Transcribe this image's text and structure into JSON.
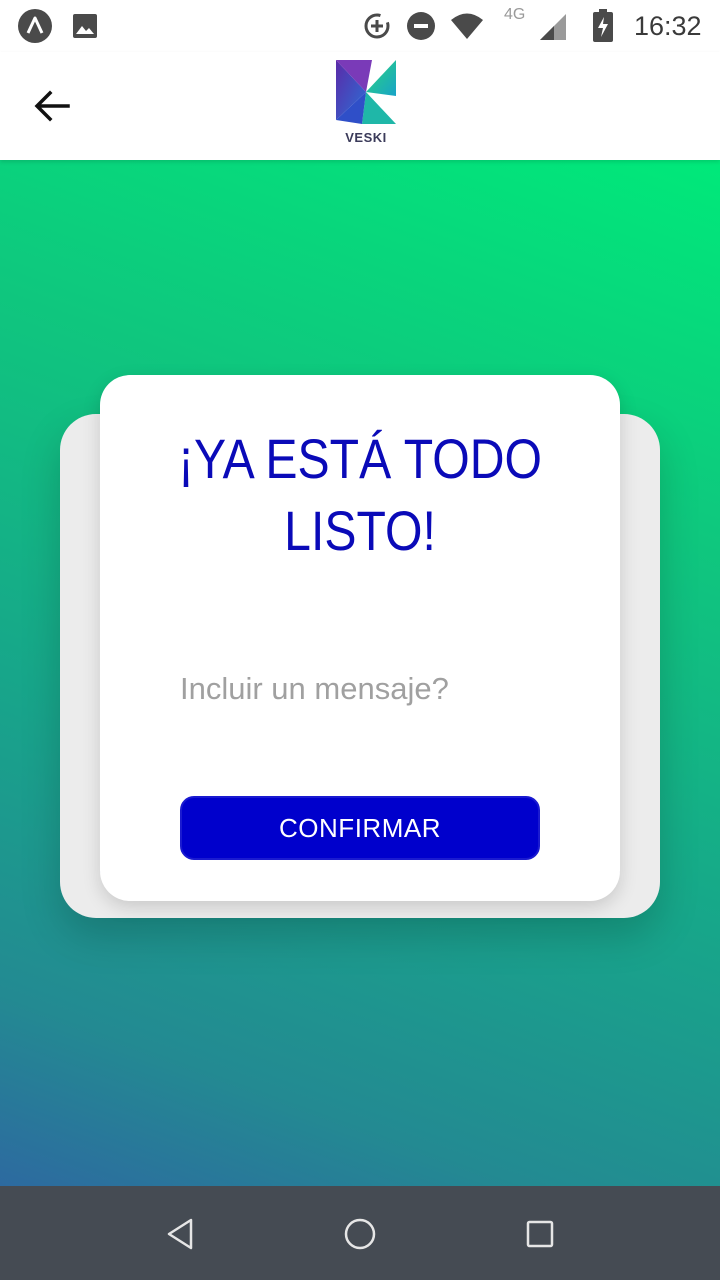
{
  "status_bar": {
    "time": "16:32",
    "network_label": "4G",
    "icons": [
      "app-icon",
      "image-icon",
      "data-saver-icon",
      "do-not-disturb-icon",
      "wifi-icon",
      "signal-icon",
      "battery-charging-icon"
    ]
  },
  "app_bar": {
    "back_icon": "arrow-left-icon",
    "logo_text": "VESKI"
  },
  "card": {
    "title": "¡YA ESTÁ TODO LISTO!",
    "message_placeholder": "Incluir un mensaje?",
    "message_value": "",
    "confirm_label": "CONFIRMAR"
  },
  "nav_bar": {
    "icons": [
      "back-triangle-icon",
      "home-circle-icon",
      "recents-square-icon"
    ]
  },
  "colors": {
    "primary_blue": "#0000cc",
    "title_blue": "#0a0ab8",
    "gradient_top": "#00e97a",
    "gradient_bottom": "#2d6aa0",
    "nav_bar": "#454b53"
  }
}
